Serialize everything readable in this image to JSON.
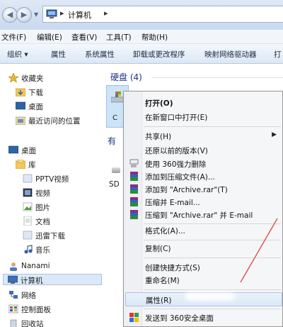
{
  "address": {
    "location": "计算机"
  },
  "menubar": {
    "items": [
      "文件(F)",
      "编辑(E)",
      "查看(V)",
      "工具(T)",
      "帮助(H)"
    ]
  },
  "toolbar": {
    "items": [
      "组织 ▾",
      "属性",
      "系统属性",
      "卸载或更改程序",
      "映射网络驱动器",
      "打"
    ]
  },
  "navpane": {
    "favorites": {
      "label": "收藏夹",
      "items": [
        "下载",
        "桌面",
        "最近访问的位置"
      ]
    },
    "desktop": "桌面",
    "libraries": {
      "label": "库",
      "items": [
        "PPTV视频",
        "视频",
        "图片",
        "文档",
        "迅雷下载",
        "音乐"
      ]
    },
    "user": "Nanami",
    "computer": "计算机",
    "network": "网络",
    "control_panel": "控制面板",
    "recycle_bin": "回收站"
  },
  "content": {
    "group_disks": "硬盘 (4)",
    "group_removable": "有",
    "drive_label": "C",
    "sd_label": "SD"
  },
  "context_menu": {
    "items": [
      {
        "label": "打开(O)",
        "bold": true,
        "icon": "none"
      },
      {
        "label": "在新窗口中打开(E)",
        "icon": "none"
      },
      {
        "label": "共享(H)",
        "icon": "none",
        "submenu": true
      },
      {
        "label": "还原以前的版本(V)",
        "icon": "none"
      },
      {
        "label": "使用 360强力删除",
        "icon": "shredder-icon"
      },
      {
        "label": "添加到压缩文件(A)...",
        "icon": "winrar-icon"
      },
      {
        "label": "添加到 \"Archive.rar\"(T)",
        "icon": "winrar-icon"
      },
      {
        "label": "压缩并 E-mail...",
        "icon": "winrar-icon"
      },
      {
        "label": "压缩到 \"Archive.rar\" 并 E-mail",
        "icon": "winrar-icon"
      },
      {
        "label": "格式化(A)...",
        "icon": "none"
      },
      {
        "label": "复制(C)",
        "icon": "none"
      },
      {
        "label": "创建快捷方式(S)",
        "icon": "none"
      },
      {
        "label": "重命名(M)",
        "icon": "none"
      },
      {
        "label": "属性(R)",
        "icon": "none",
        "highlighted": true
      },
      {
        "label": "发送到 360安全桌面",
        "icon": "360-desktop-icon"
      }
    ]
  },
  "colors": {
    "group_header": "#1e3287",
    "highlight_border": "#a7c4e6",
    "annotation_line": "#d9534f"
  }
}
